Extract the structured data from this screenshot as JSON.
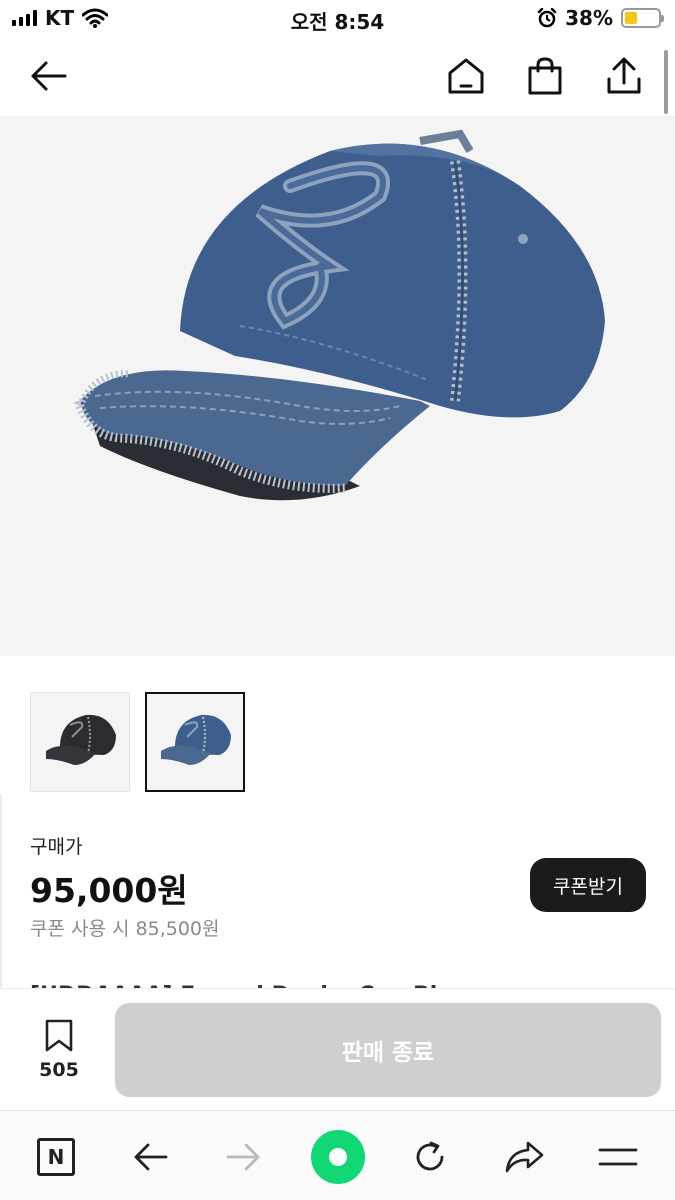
{
  "status_bar": {
    "carrier": "KT",
    "time": "오전 8:54",
    "battery_percent": "38%",
    "battery_level": 0.38
  },
  "header": {
    "icons": [
      "back-arrow-icon",
      "home-icon",
      "shopping-bag-icon",
      "share-icon"
    ]
  },
  "product": {
    "image_icon": "denim-cap",
    "thumbnails": [
      {
        "variant": "black",
        "selected": false
      },
      {
        "variant": "blue",
        "selected": true
      }
    ],
    "price_label": "구매가",
    "price": "95,000원",
    "coupon_price": "쿠폰 사용 시 85,500원",
    "coupon_button": "쿠폰받기",
    "title_peek": "[UDDAAAA] Frayed Denim Cap Blue"
  },
  "action_bar": {
    "wish_count": "505",
    "sold_out_label": "판매 종료"
  },
  "browser_toolbar": {
    "icons": [
      "naver-n-icon",
      "back-arrow-icon",
      "forward-arrow-icon",
      "green-dot-icon",
      "refresh-icon",
      "share-icon",
      "menu-icon"
    ]
  },
  "colors": {
    "accent_green": "#11d874",
    "sold_out_bg": "#cfcfcf",
    "coupon_bg": "#1b1b1b",
    "battery_fill": "#f5c518"
  }
}
